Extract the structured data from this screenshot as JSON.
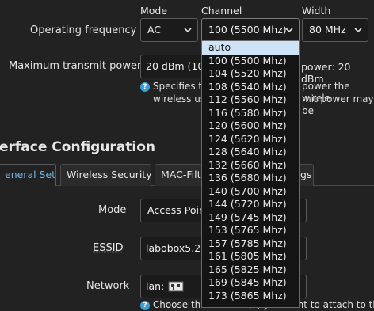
{
  "wireless": {
    "headers": {
      "mode": "Mode",
      "channel": "Channel",
      "width": "Width"
    },
    "operating_frequency": {
      "label": "Operating frequency",
      "mode_value": "AC",
      "channel_value": "100 (5500 Mhz)",
      "width_value": "80 MHz"
    },
    "tx_power": {
      "label": "Maximum transmit power",
      "value": "20 dBm (10",
      "right_text": "power: 20 dBm",
      "help_line1_left": "Specifies th",
      "help_line1_right": "power the wirele",
      "help_line2_left": "wireless us",
      "help_line2_right": "mit power may be"
    }
  },
  "interface": {
    "title": "erface Configuration",
    "tabs": [
      {
        "label": "eneral Setup",
        "active": true
      },
      {
        "label": "Wireless Security",
        "active": false
      },
      {
        "label": "MAC-Filte",
        "active": false
      },
      {
        "label": "gs",
        "active": false
      }
    ],
    "mode": {
      "label": "Mode",
      "value": "Access Poin"
    },
    "essid": {
      "label": "ESSID",
      "value": "labobox5.2"
    },
    "network": {
      "label": "Network",
      "value": "lan:",
      "help_text": "Choose the network(s) you want to attach to this"
    }
  },
  "channel_dropdown": {
    "options": [
      "auto",
      "100 (5500 Mhz)",
      "104 (5520 Mhz)",
      "108 (5540 Mhz)",
      "112 (5560 Mhz)",
      "116 (5580 Mhz)",
      "120 (5600 Mhz)",
      "124 (5620 Mhz)",
      "128 (5640 Mhz)",
      "132 (5660 Mhz)",
      "136 (5680 Mhz)",
      "140 (5700 Mhz)",
      "144 (5720 Mhz)",
      "149 (5745 Mhz)",
      "153 (5765 Mhz)",
      "157 (5785 Mhz)",
      "161 (5805 Mhz)",
      "165 (5825 Mhz)",
      "169 (5845 Mhz)",
      "173 (5865 Mhz)"
    ],
    "highlighted": "auto"
  },
  "colors": {
    "accent": "#6fb8e6",
    "highlight": "#cfe3f7",
    "help_icon": "#39a0d6"
  },
  "icons": {
    "chevron": "chevron-down-icon",
    "help": "help-icon",
    "network": "network-interface-icon"
  }
}
